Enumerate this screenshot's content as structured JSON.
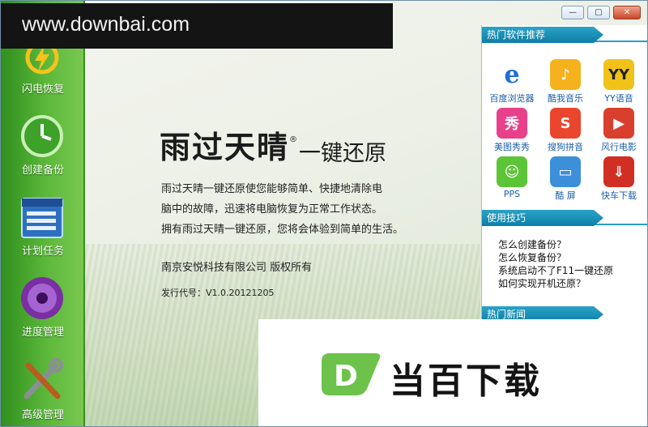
{
  "watermark": {
    "url": "www.downbai.com"
  },
  "window_controls": {
    "minimize": "—",
    "restore": "▢",
    "close": "✕"
  },
  "sidebar": {
    "items": [
      {
        "label": "闪电恢复",
        "icon": "lightning-restore-icon"
      },
      {
        "label": "创建备份",
        "icon": "clock-backup-icon"
      },
      {
        "label": "计划任务",
        "icon": "calendar-task-icon"
      },
      {
        "label": "进度管理",
        "icon": "progress-disc-icon"
      },
      {
        "label": "高级管理",
        "icon": "wrench-tools-icon"
      }
    ]
  },
  "main": {
    "logo_main": "雨过天晴",
    "logo_reg": "®",
    "logo_sub": "一键还原",
    "desc_lines": [
      "雨过天晴一键还原使您能够简单、快捷地清除电",
      "脑中的故障，迅速将电脑恢复为正常工作状态。",
      "拥有雨过天晴一键还原，您将会体验到简单的生活。"
    ],
    "copyright": "南京安悦科技有限公司 版权所有",
    "version": "发行代号：V1.0.20121205"
  },
  "right_panel": {
    "hot_software_title": "热门软件推荐",
    "apps": [
      {
        "label": "百度浏览器",
        "icon": "baidu-browser-icon",
        "color": "#1e6fd9"
      },
      {
        "label": "酷我音乐",
        "icon": "kuwo-music-icon",
        "color": "#f5b21c"
      },
      {
        "label": "YY语音",
        "icon": "yy-voice-icon",
        "color": "#f0c21a"
      },
      {
        "label": "美图秀秀",
        "icon": "meitu-icon",
        "color": "#e8418a"
      },
      {
        "label": "搜狗拼音",
        "icon": "sogou-pinyin-icon",
        "color": "#e9462d"
      },
      {
        "label": "风行电影",
        "icon": "funshion-icon",
        "color": "#d93f2c"
      },
      {
        "label": "PPS",
        "icon": "pps-icon",
        "color": "#5cc437"
      },
      {
        "label": "酷 屏",
        "icon": "kuping-icon",
        "color": "#3c8fd9"
      },
      {
        "label": "快车下载",
        "icon": "flashget-icon",
        "color": "#d12f24"
      }
    ],
    "tips_title": "使用技巧",
    "tips": [
      "怎么创建备份？",
      "怎么恢复备份？",
      "系统启动不了F11一键还原",
      "如何实现开机还原？"
    ],
    "news_title": "热门新闻"
  },
  "brand": {
    "text": "当百下载",
    "logo_letter": "D",
    "logo_color": "#6cc24a"
  }
}
